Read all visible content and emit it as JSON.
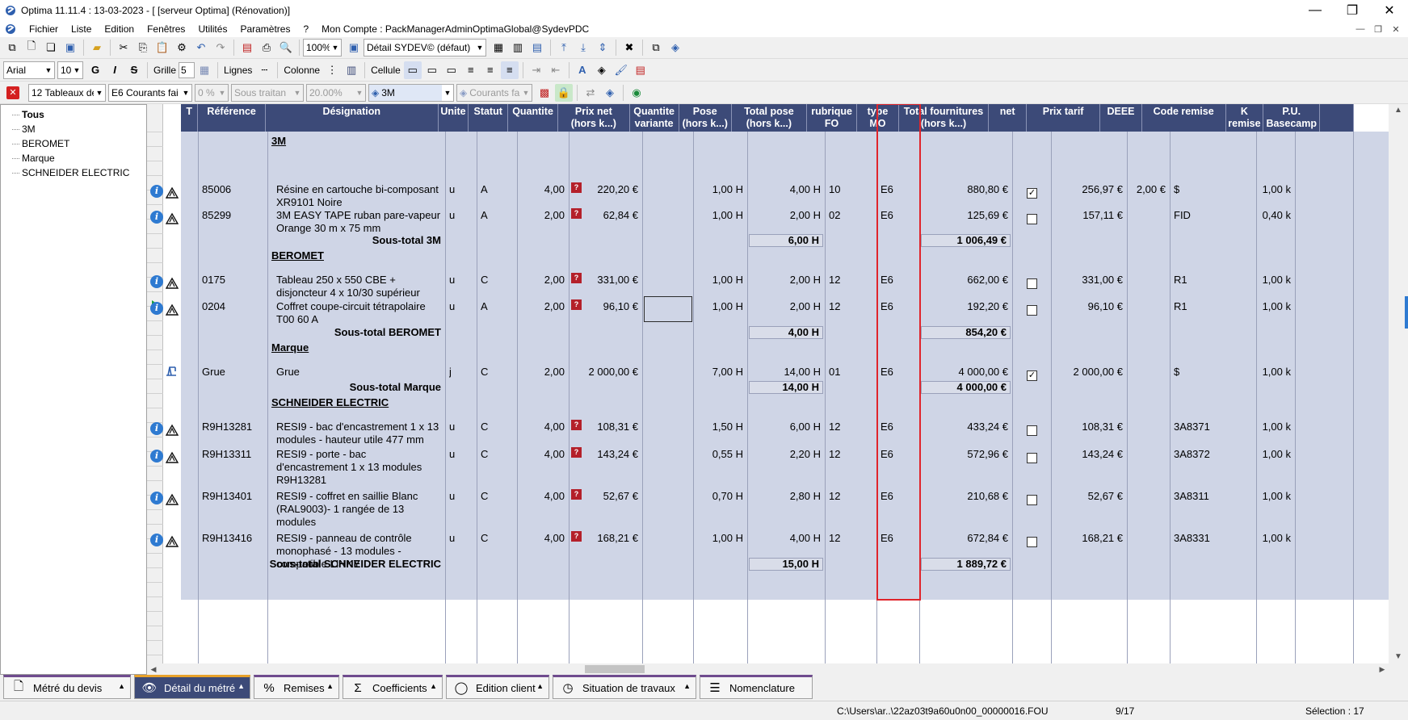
{
  "window": {
    "title": "Optima 11.11.4 : 13-03-2023 - [ [serveur Optima] (Rénovation)]",
    "minimize": "—",
    "restore": "❐",
    "close": "✕"
  },
  "menubar": {
    "items": [
      "Fichier",
      "Liste",
      "Edition",
      "Fenêtres",
      "Utilités",
      "Paramètres",
      "?",
      "Mon Compte : PackManagerAdminOptimaGlobal@SydevPDC"
    ]
  },
  "toolbar1": {
    "zoom": "100%",
    "view": "Détail SYDEV© (défaut)"
  },
  "toolbar2": {
    "font": "Arial",
    "size": "10",
    "bold": "G",
    "italic": "I",
    "strike": "S",
    "grid_label": "Grille",
    "grid_value": "5",
    "lines_label": "Lignes",
    "column_label": "Colonne",
    "cell_label": "Cellule"
  },
  "toolbar3": {
    "tables": "12  Tableaux de",
    "labour": "E6  Courants fai",
    "pct": "0 %",
    "subcontract": "Sous traitan",
    "rate": "20.00%",
    "brand": "3M",
    "category": "Courants fa"
  },
  "tree": {
    "items": [
      "Tous",
      "3M",
      "BEROMET",
      "Marque",
      "SCHNEIDER ELECTRIC"
    ]
  },
  "columns": [
    {
      "key": "t",
      "label": "T"
    },
    {
      "key": "ref",
      "label": "Référence"
    },
    {
      "key": "des",
      "label": "Désignation"
    },
    {
      "key": "unit",
      "label": "Unite"
    },
    {
      "key": "status",
      "label": "Statut"
    },
    {
      "key": "qty",
      "label": "Quantite"
    },
    {
      "key": "net_price",
      "label": "Prix net\n(hors k...)"
    },
    {
      "key": "qty_var",
      "label": "Quantite\nvariante"
    },
    {
      "key": "pose",
      "label": "Pose\n(hors k...)"
    },
    {
      "key": "total_pose",
      "label": "Total pose\n(hors k...)"
    },
    {
      "key": "rubrique",
      "label": "rubrique\nFO"
    },
    {
      "key": "type_mo",
      "label": "type\nMO"
    },
    {
      "key": "total_fourn",
      "label": "Total fournitures\n(hors k...)"
    },
    {
      "key": "net",
      "label": "net"
    },
    {
      "key": "prix_tarif",
      "label": "Prix tarif"
    },
    {
      "key": "deee",
      "label": "DEEE"
    },
    {
      "key": "code_remise",
      "label": "Code remise"
    },
    {
      "key": "k_remise",
      "label": "K\nremise"
    },
    {
      "key": "pu_basecamp",
      "label": "P.U.\nBasecamp"
    }
  ],
  "groups": [
    {
      "title": "3M",
      "rows": [
        {
          "ref": "85006",
          "des": "Résine en cartouche bi-composant\nXR9101 Noire",
          "unit": "u",
          "status": "A",
          "qty": "4,00",
          "net_price": "220,20 €",
          "pose": "1,00 H",
          "total_pose": "4,00 H",
          "rubrique": "10",
          "type_mo": "E6",
          "total_fourn": "880,80 €",
          "net": "✓",
          "prix_tarif": "256,97 €",
          "deee": "2,00 €",
          "code_remise": "$",
          "k_remise": "1,00 k"
        },
        {
          "ref": "85299",
          "des": "3M EASY TAPE ruban pare-vapeur\nOrange 30 m x 75 mm",
          "unit": "u",
          "status": "A",
          "qty": "2,00",
          "net_price": "62,84 €",
          "pose": "1,00 H",
          "total_pose": "2,00 H",
          "rubrique": "02",
          "type_mo": "E6",
          "total_fourn": "125,69 €",
          "net": "",
          "prix_tarif": "157,11 €",
          "deee": "",
          "code_remise": "FID",
          "k_remise": "0,40 k"
        }
      ],
      "subtotal_label": "Sous-total 3M",
      "subtotal_pose": "6,00 H",
      "subtotal_fourn": "1 006,49 €"
    },
    {
      "title": "BEROMET",
      "rows": [
        {
          "ref": "0175",
          "des": "Tableau 250 x 550 CBE +\ndisjoncteur 4 x 10/30 supérieur",
          "unit": "u",
          "status": "C",
          "qty": "2,00",
          "net_price": "331,00 €",
          "pose": "1,00 H",
          "total_pose": "2,00 H",
          "rubrique": "12",
          "type_mo": "E6",
          "total_fourn": "662,00 €",
          "net": "",
          "prix_tarif": "331,00 €",
          "deee": "",
          "code_remise": "R1",
          "k_remise": "1,00 k"
        },
        {
          "ref": "0204",
          "des": "Coffret coupe-circuit tétrapolaire\nT00 60 A",
          "unit": "u",
          "status": "A",
          "qty": "2,00",
          "net_price": "96,10 €",
          "pose": "1,00 H",
          "total_pose": "2,00 H",
          "rubrique": "12",
          "type_mo": "E6",
          "total_fourn": "192,20 €",
          "net": "",
          "prix_tarif": "96,10 €",
          "deee": "",
          "code_remise": "R1",
          "k_remise": "1,00 k"
        }
      ],
      "subtotal_label": "Sous-total BEROMET",
      "subtotal_pose": "4,00 H",
      "subtotal_fourn": "854,20 €"
    },
    {
      "title": "Marque",
      "rows": [
        {
          "ref": "Grue",
          "des": "Grue",
          "unit": "j",
          "status": "C",
          "qty": "2,00",
          "net_price": "2 000,00 €",
          "pose": "7,00 H",
          "total_pose": "14,00 H",
          "rubrique": "01",
          "type_mo": "E6",
          "total_fourn": "4 000,00 €",
          "net": "✓",
          "prix_tarif": "2 000,00 €",
          "deee": "",
          "code_remise": "$",
          "k_remise": "1,00 k"
        }
      ],
      "subtotal_label": "Sous-total Marque",
      "subtotal_pose": "14,00 H",
      "subtotal_fourn": "4 000,00 €"
    },
    {
      "title": "SCHNEIDER ELECTRIC",
      "rows": [
        {
          "ref": "R9H13281",
          "des": "RESI9 - bac d'encastrement 1 x 13\nmodules - hauteur utile 477 mm",
          "unit": "u",
          "status": "C",
          "qty": "4,00",
          "net_price": "108,31 €",
          "pose": "1,50 H",
          "total_pose": "6,00 H",
          "rubrique": "12",
          "type_mo": "E6",
          "total_fourn": "433,24 €",
          "net": "",
          "prix_tarif": "108,31 €",
          "deee": "",
          "code_remise": "3A8371",
          "k_remise": "1,00 k"
        },
        {
          "ref": "R9H13311",
          "des": "RESI9 - porte - bac\nd'encastrement 1 x 13 modules\nR9H13281",
          "unit": "u",
          "status": "C",
          "qty": "4,00",
          "net_price": "143,24 €",
          "pose": "0,55 H",
          "total_pose": "2,20 H",
          "rubrique": "12",
          "type_mo": "E6",
          "total_fourn": "572,96 €",
          "net": "",
          "prix_tarif": "143,24 €",
          "deee": "",
          "code_remise": "3A8372",
          "k_remise": "1,00 k"
        },
        {
          "ref": "R9H13401",
          "des": "RESI9 - coffret en saillie Blanc\n(RAL9003)- 1 rangée de 13\nmodules",
          "unit": "u",
          "status": "C",
          "qty": "4,00",
          "net_price": "52,67 €",
          "pose": "0,70 H",
          "total_pose": "2,80 H",
          "rubrique": "12",
          "type_mo": "E6",
          "total_fourn": "210,68 €",
          "net": "",
          "prix_tarif": "52,67 €",
          "deee": "",
          "code_remise": "3A8311",
          "k_remise": "1,00 k"
        },
        {
          "ref": "R9H13416",
          "des": "RESI9 - panneau de contrôle\nmonophasé - 13 modules -\ncompatible LINKY",
          "unit": "u",
          "status": "C",
          "qty": "4,00",
          "net_price": "168,21 €",
          "pose": "1,00 H",
          "total_pose": "4,00 H",
          "rubrique": "12",
          "type_mo": "E6",
          "total_fourn": "672,84 €",
          "net": "",
          "prix_tarif": "168,21 €",
          "deee": "",
          "code_remise": "3A8331",
          "k_remise": "1,00 k"
        }
      ],
      "subtotal_label": "Sous-total SCHNEIDER ELECTRIC",
      "subtotal_pose": "15,00 H",
      "subtotal_fourn": "1 889,72 €"
    }
  ],
  "tabs": [
    {
      "label": "Métré du devis",
      "icon": "document-icon",
      "active": false
    },
    {
      "label": "Détail du métré",
      "icon": "eye-icon",
      "active": true
    },
    {
      "label": "Remises",
      "icon": "percent-icon",
      "active": false
    },
    {
      "label": "Coefficients",
      "icon": "sigma-icon",
      "active": false
    },
    {
      "label": "Edition client",
      "icon": "user-icon",
      "active": false
    },
    {
      "label": "Situation de travaux",
      "icon": "clock-icon",
      "active": false
    },
    {
      "label": "Nomenclature",
      "icon": "list-icon",
      "active": false
    }
  ],
  "status": {
    "path": "C:\\Users\\ar..\\22az03t9a60u0n00_00000016.FOU",
    "position": "9/17",
    "selection": "Sélection : 17"
  },
  "colors": {
    "header_bg": "#3c4a78",
    "row_bg": "#cfd5e6",
    "highlight": "#e0242b",
    "active_tab": "#3c4a78"
  }
}
